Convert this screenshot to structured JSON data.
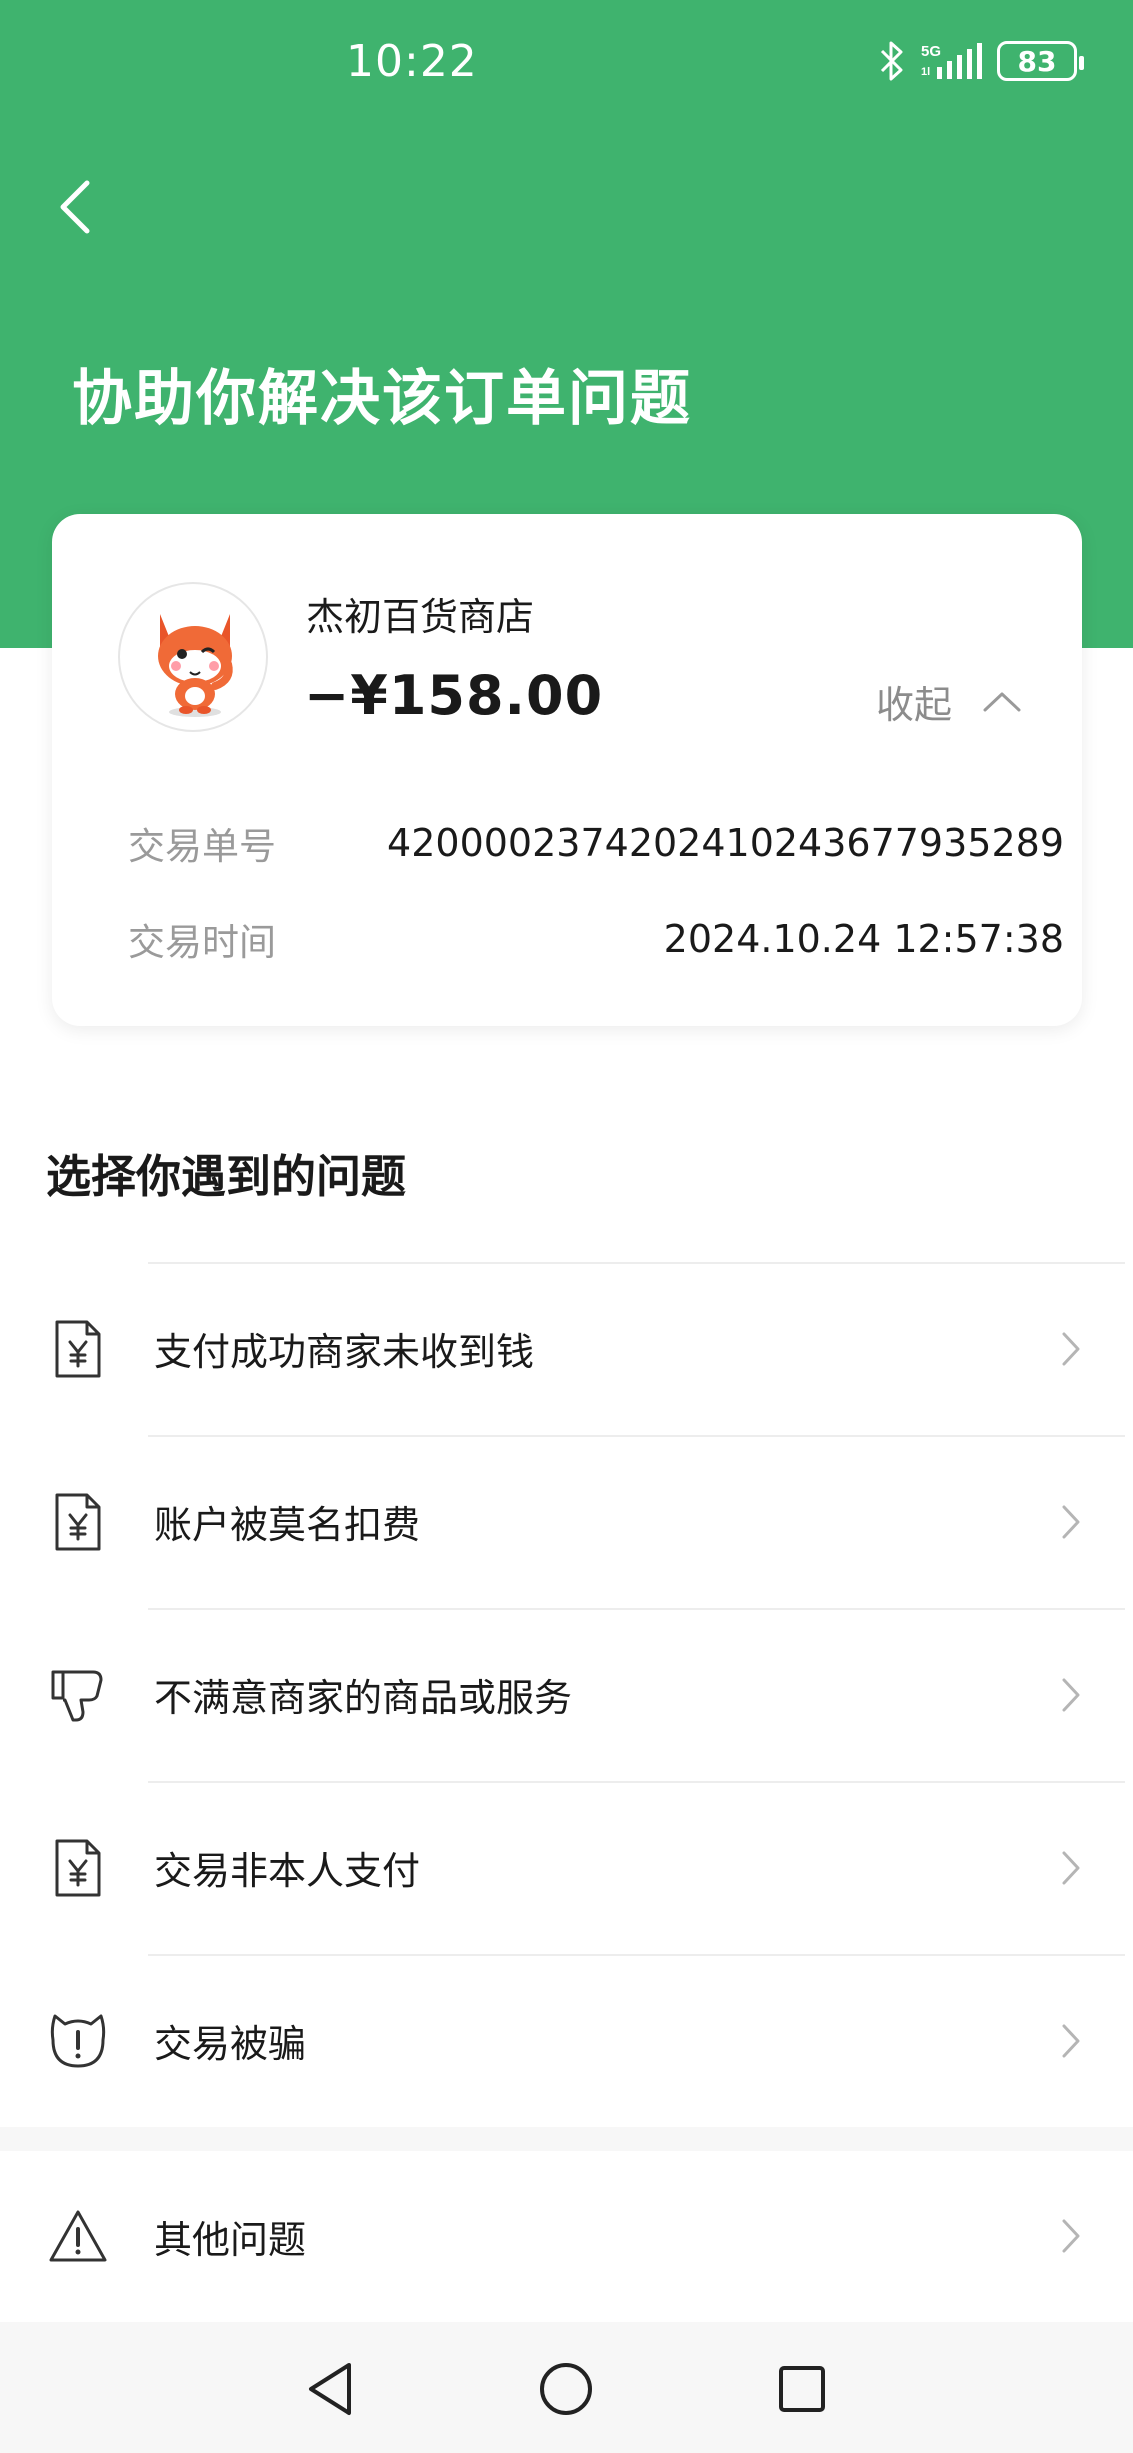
{
  "status_bar": {
    "time": "10:22",
    "battery": "83",
    "network": "5G",
    "icons": [
      "bluetooth-icon",
      "signal-5g-icon",
      "battery-icon"
    ]
  },
  "header": {
    "title": "协助你解决该订单问题",
    "background_color": "#3fb36e"
  },
  "order": {
    "merchant_name": "杰初百货商店",
    "amount": "−¥158.00",
    "collapse_label": "收起",
    "transaction_number_label": "交易单号",
    "transaction_number": "4200002374202410243677935289",
    "transaction_time_label": "交易时间",
    "transaction_time": "2024.10.24 12:57:38"
  },
  "issues": {
    "section_title": "选择你遇到的问题",
    "items": [
      {
        "label": "支付成功商家未收到钱",
        "icon": "receipt-yen-icon"
      },
      {
        "label": "账户被莫名扣费",
        "icon": "receipt-yen-icon"
      },
      {
        "label": "不满意商家的商品或服务",
        "icon": "thumbs-down-icon"
      },
      {
        "label": "交易非本人支付",
        "icon": "receipt-yen-icon"
      },
      {
        "label": "交易被骗",
        "icon": "alert-shield-icon"
      }
    ],
    "other": {
      "label": "其他问题",
      "icon": "warning-triangle-icon"
    }
  },
  "nav": {
    "icons": [
      "back-triangle-icon",
      "home-circle-icon",
      "recents-square-icon"
    ]
  }
}
